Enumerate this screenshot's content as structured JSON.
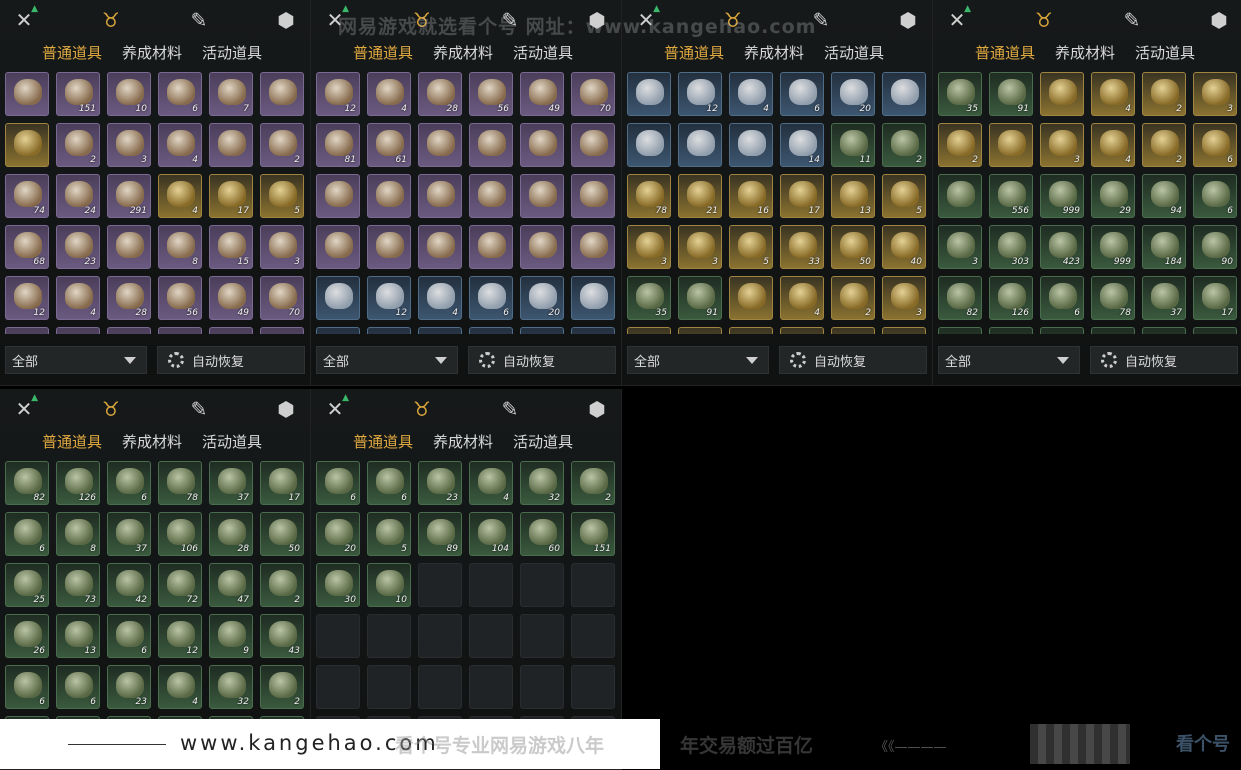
{
  "tabs": [
    "普通道具",
    "养成材料",
    "活动道具"
  ],
  "active_tab": 0,
  "filter_label": "全部",
  "auto_restore_label": "自动恢复",
  "watermark_top": "网易游戏就选看个号 网址：www.kangehao.com",
  "footer": {
    "url": "www.kangehao.com",
    "slogan1": "看个号专业网易游戏八年",
    "slogan2": "年交易额过百亿",
    "deco": "《《————",
    "logo": "看个号"
  },
  "panels": [
    {
      "rows": [
        [
          [
            "purple",
            ""
          ],
          [
            "purple",
            "151"
          ],
          [
            "purple",
            "10"
          ],
          [
            "purple",
            "6"
          ],
          [
            "purple",
            "7"
          ],
          [
            "purple",
            ""
          ]
        ],
        [
          [
            "gold",
            ""
          ],
          [
            "purple",
            "2"
          ],
          [
            "purple",
            "3"
          ],
          [
            "purple",
            "4"
          ],
          [
            "purple",
            ""
          ],
          [
            "purple",
            "2"
          ]
        ],
        [
          [
            "purple",
            "74"
          ],
          [
            "purple",
            "24"
          ],
          [
            "purple",
            "291"
          ],
          [
            "gold",
            "4"
          ],
          [
            "gold",
            "17"
          ],
          [
            "gold",
            "5"
          ]
        ],
        [
          [
            "purple",
            "68"
          ],
          [
            "purple",
            "23"
          ],
          [
            "purple",
            ""
          ],
          [
            "purple",
            "8"
          ],
          [
            "purple",
            "15"
          ],
          [
            "purple",
            "3"
          ]
        ],
        [
          [
            "purple",
            "12"
          ],
          [
            "purple",
            "4"
          ],
          [
            "purple",
            "28"
          ],
          [
            "purple",
            "56"
          ],
          [
            "purple",
            "49"
          ],
          [
            "purple",
            "70"
          ]
        ],
        [
          [
            "purple",
            ""
          ],
          [
            "purple",
            ""
          ],
          [
            "purple",
            ""
          ],
          [
            "purple",
            ""
          ],
          [
            "purple",
            ""
          ],
          [
            "purple",
            ""
          ]
        ]
      ]
    },
    {
      "rows": [
        [
          [
            "purple",
            "12"
          ],
          [
            "purple",
            "4"
          ],
          [
            "purple",
            "28"
          ],
          [
            "purple",
            "56"
          ],
          [
            "purple",
            "49"
          ],
          [
            "purple",
            "70"
          ]
        ],
        [
          [
            "purple",
            "81"
          ],
          [
            "purple",
            "61"
          ],
          [
            "purple",
            ""
          ],
          [
            "purple",
            ""
          ],
          [
            "purple",
            ""
          ],
          [
            "purple",
            ""
          ]
        ],
        [
          [
            "purple",
            ""
          ],
          [
            "purple",
            ""
          ],
          [
            "purple",
            ""
          ],
          [
            "purple",
            ""
          ],
          [
            "purple",
            ""
          ],
          [
            "purple",
            ""
          ]
        ],
        [
          [
            "purple",
            ""
          ],
          [
            "purple",
            ""
          ],
          [
            "purple",
            ""
          ],
          [
            "purple",
            ""
          ],
          [
            "purple",
            ""
          ],
          [
            "purple",
            ""
          ]
        ],
        [
          [
            "blue",
            ""
          ],
          [
            "blue",
            "12"
          ],
          [
            "blue",
            "4"
          ],
          [
            "blue",
            "6"
          ],
          [
            "blue",
            "20"
          ],
          [
            "blue",
            ""
          ]
        ],
        [
          [
            "blue",
            ""
          ],
          [
            "blue",
            ""
          ],
          [
            "blue",
            ""
          ],
          [
            "blue",
            ""
          ],
          [
            "blue",
            ""
          ],
          [
            "blue",
            ""
          ]
        ]
      ]
    },
    {
      "rows": [
        [
          [
            "blue",
            ""
          ],
          [
            "blue",
            "12"
          ],
          [
            "blue",
            "4"
          ],
          [
            "blue",
            "6"
          ],
          [
            "blue",
            "20"
          ],
          [
            "blue",
            ""
          ]
        ],
        [
          [
            "blue",
            ""
          ],
          [
            "blue",
            ""
          ],
          [
            "blue",
            ""
          ],
          [
            "blue",
            "14"
          ],
          [
            "green",
            "11"
          ],
          [
            "green",
            "2"
          ]
        ],
        [
          [
            "gold",
            "78"
          ],
          [
            "gold",
            "21"
          ],
          [
            "gold",
            "16"
          ],
          [
            "gold",
            "17"
          ],
          [
            "gold",
            "13"
          ],
          [
            "gold",
            "5"
          ]
        ],
        [
          [
            "gold",
            "3"
          ],
          [
            "gold",
            "3"
          ],
          [
            "gold",
            "5"
          ],
          [
            "gold",
            "33"
          ],
          [
            "gold",
            "50"
          ],
          [
            "gold",
            "40"
          ]
        ],
        [
          [
            "green",
            "35"
          ],
          [
            "green",
            "91"
          ],
          [
            "gold",
            ""
          ],
          [
            "gold",
            "4"
          ],
          [
            "gold",
            "2"
          ],
          [
            "gold",
            "3"
          ]
        ],
        [
          [
            "gold",
            ""
          ],
          [
            "gold",
            ""
          ],
          [
            "gold",
            ""
          ],
          [
            "gold",
            ""
          ],
          [
            "gold",
            ""
          ],
          [
            "gold",
            ""
          ]
        ]
      ]
    },
    {
      "rows": [
        [
          [
            "green",
            "35"
          ],
          [
            "green",
            "91"
          ],
          [
            "gold",
            ""
          ],
          [
            "gold",
            "4"
          ],
          [
            "gold",
            "2"
          ],
          [
            "gold",
            "3"
          ]
        ],
        [
          [
            "gold",
            "2"
          ],
          [
            "gold",
            ""
          ],
          [
            "gold",
            "3"
          ],
          [
            "gold",
            "4"
          ],
          [
            "gold",
            "2"
          ],
          [
            "gold",
            "6"
          ]
        ],
        [
          [
            "green",
            ""
          ],
          [
            "green",
            "556"
          ],
          [
            "green",
            "999"
          ],
          [
            "green",
            "29"
          ],
          [
            "green",
            "94"
          ],
          [
            "green",
            "6"
          ]
        ],
        [
          [
            "green",
            "3"
          ],
          [
            "green",
            "303"
          ],
          [
            "green",
            "423"
          ],
          [
            "green",
            "999"
          ],
          [
            "green",
            "184"
          ],
          [
            "green",
            "90"
          ]
        ],
        [
          [
            "green",
            "82"
          ],
          [
            "green",
            "126"
          ],
          [
            "green",
            "6"
          ],
          [
            "green",
            "78"
          ],
          [
            "green",
            "37"
          ],
          [
            "green",
            "17"
          ]
        ],
        [
          [
            "green",
            ""
          ],
          [
            "green",
            ""
          ],
          [
            "green",
            ""
          ],
          [
            "green",
            ""
          ],
          [
            "green",
            ""
          ],
          [
            "green",
            ""
          ]
        ]
      ]
    },
    {
      "rows": [
        [
          [
            "green",
            "82"
          ],
          [
            "green",
            "126"
          ],
          [
            "green",
            "6"
          ],
          [
            "green",
            "78"
          ],
          [
            "green",
            "37"
          ],
          [
            "green",
            "17"
          ]
        ],
        [
          [
            "green",
            "6"
          ],
          [
            "green",
            "8"
          ],
          [
            "green",
            "37"
          ],
          [
            "green",
            "106"
          ],
          [
            "green",
            "28"
          ],
          [
            "green",
            "50"
          ]
        ],
        [
          [
            "green",
            "25"
          ],
          [
            "green",
            "73"
          ],
          [
            "green",
            "42"
          ],
          [
            "green",
            "72"
          ],
          [
            "green",
            "47"
          ],
          [
            "green",
            "2"
          ]
        ],
        [
          [
            "green",
            "26"
          ],
          [
            "green",
            "13"
          ],
          [
            "green",
            "6"
          ],
          [
            "green",
            "12"
          ],
          [
            "green",
            "9"
          ],
          [
            "green",
            "43"
          ]
        ],
        [
          [
            "green",
            "6"
          ],
          [
            "green",
            "6"
          ],
          [
            "green",
            "23"
          ],
          [
            "green",
            "4"
          ],
          [
            "green",
            "32"
          ],
          [
            "green",
            "2"
          ]
        ],
        [
          [
            "green",
            ""
          ],
          [
            "green",
            ""
          ],
          [
            "green",
            ""
          ],
          [
            "green",
            ""
          ],
          [
            "green",
            ""
          ],
          [
            "green",
            ""
          ]
        ]
      ]
    },
    {
      "rows": [
        [
          [
            "green",
            "6"
          ],
          [
            "green",
            "6"
          ],
          [
            "green",
            "23"
          ],
          [
            "green",
            "4"
          ],
          [
            "green",
            "32"
          ],
          [
            "green",
            "2"
          ]
        ],
        [
          [
            "green",
            "20"
          ],
          [
            "green",
            "5"
          ],
          [
            "green",
            "89"
          ],
          [
            "green",
            "104"
          ],
          [
            "green",
            "60"
          ],
          [
            "green",
            "151"
          ]
        ],
        [
          [
            "green",
            "30"
          ],
          [
            "green",
            "10"
          ],
          [
            "empty",
            ""
          ],
          [
            "empty",
            ""
          ],
          [
            "empty",
            ""
          ],
          [
            "empty",
            ""
          ]
        ],
        [
          [
            "empty",
            ""
          ],
          [
            "empty",
            ""
          ],
          [
            "empty",
            ""
          ],
          [
            "empty",
            ""
          ],
          [
            "empty",
            ""
          ],
          [
            "empty",
            ""
          ]
        ],
        [
          [
            "empty",
            ""
          ],
          [
            "empty",
            ""
          ],
          [
            "empty",
            ""
          ],
          [
            "empty",
            ""
          ],
          [
            "empty",
            ""
          ],
          [
            "empty",
            ""
          ]
        ],
        [
          [
            "empty",
            ""
          ],
          [
            "empty",
            ""
          ],
          [
            "empty",
            ""
          ],
          [
            "empty",
            ""
          ],
          [
            "empty",
            ""
          ],
          [
            "empty",
            ""
          ]
        ]
      ]
    }
  ]
}
